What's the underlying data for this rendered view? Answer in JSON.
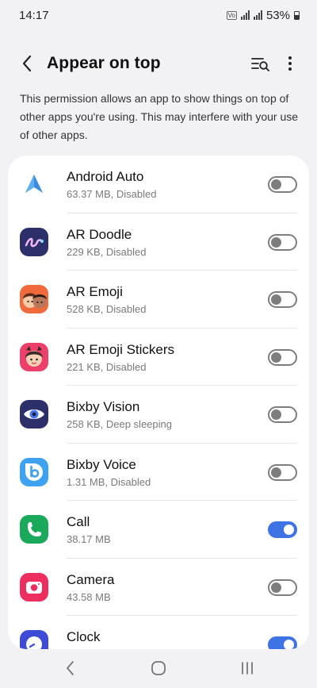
{
  "status_bar": {
    "time": "14:17",
    "battery_percent": "53%"
  },
  "header": {
    "title": "Appear on top"
  },
  "description": "This permission allows an app to show things on top of other apps you're using. This may interfere with your use of other apps.",
  "colors": {
    "accent": "#3e73e6",
    "toggle_off": "#7d7d7d",
    "background": "#f2f2f5"
  },
  "apps": [
    {
      "name": "Android Auto",
      "subtitle": "63.37 MB, Disabled",
      "enabled": false,
      "icon": "android-auto-icon"
    },
    {
      "name": "AR Doodle",
      "subtitle": "229 KB, Disabled",
      "enabled": false,
      "icon": "ar-doodle-icon"
    },
    {
      "name": "AR Emoji",
      "subtitle": "528 KB, Disabled",
      "enabled": false,
      "icon": "ar-emoji-icon"
    },
    {
      "name": "AR Emoji Stickers",
      "subtitle": "221 KB, Disabled",
      "enabled": false,
      "icon": "ar-emoji-stickers-icon"
    },
    {
      "name": "Bixby Vision",
      "subtitle": "258 KB, Deep sleeping",
      "enabled": false,
      "icon": "bixby-vision-icon"
    },
    {
      "name": "Bixby Voice",
      "subtitle": "1.31 MB, Disabled",
      "enabled": false,
      "icon": "bixby-voice-icon"
    },
    {
      "name": "Call",
      "subtitle": "38.17 MB",
      "enabled": true,
      "icon": "phone-icon"
    },
    {
      "name": "Camera",
      "subtitle": "43.58 MB",
      "enabled": false,
      "icon": "camera-icon"
    },
    {
      "name": "Clock",
      "subtitle": "",
      "enabled": true,
      "icon": "clock-icon"
    }
  ]
}
